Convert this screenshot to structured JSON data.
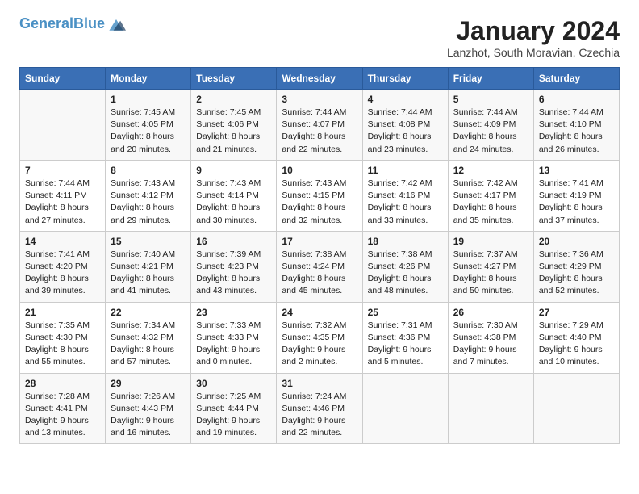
{
  "header": {
    "logo_line1": "General",
    "logo_line2": "Blue",
    "main_title": "January 2024",
    "subtitle": "Lanzhot, South Moravian, Czechia"
  },
  "days_of_week": [
    "Sunday",
    "Monday",
    "Tuesday",
    "Wednesday",
    "Thursday",
    "Friday",
    "Saturday"
  ],
  "weeks": [
    [
      {
        "day": "",
        "info": ""
      },
      {
        "day": "1",
        "info": "Sunrise: 7:45 AM\nSunset: 4:05 PM\nDaylight: 8 hours\nand 20 minutes."
      },
      {
        "day": "2",
        "info": "Sunrise: 7:45 AM\nSunset: 4:06 PM\nDaylight: 8 hours\nand 21 minutes."
      },
      {
        "day": "3",
        "info": "Sunrise: 7:44 AM\nSunset: 4:07 PM\nDaylight: 8 hours\nand 22 minutes."
      },
      {
        "day": "4",
        "info": "Sunrise: 7:44 AM\nSunset: 4:08 PM\nDaylight: 8 hours\nand 23 minutes."
      },
      {
        "day": "5",
        "info": "Sunrise: 7:44 AM\nSunset: 4:09 PM\nDaylight: 8 hours\nand 24 minutes."
      },
      {
        "day": "6",
        "info": "Sunrise: 7:44 AM\nSunset: 4:10 PM\nDaylight: 8 hours\nand 26 minutes."
      }
    ],
    [
      {
        "day": "7",
        "info": "Sunrise: 7:44 AM\nSunset: 4:11 PM\nDaylight: 8 hours\nand 27 minutes."
      },
      {
        "day": "8",
        "info": "Sunrise: 7:43 AM\nSunset: 4:12 PM\nDaylight: 8 hours\nand 29 minutes."
      },
      {
        "day": "9",
        "info": "Sunrise: 7:43 AM\nSunset: 4:14 PM\nDaylight: 8 hours\nand 30 minutes."
      },
      {
        "day": "10",
        "info": "Sunrise: 7:43 AM\nSunset: 4:15 PM\nDaylight: 8 hours\nand 32 minutes."
      },
      {
        "day": "11",
        "info": "Sunrise: 7:42 AM\nSunset: 4:16 PM\nDaylight: 8 hours\nand 33 minutes."
      },
      {
        "day": "12",
        "info": "Sunrise: 7:42 AM\nSunset: 4:17 PM\nDaylight: 8 hours\nand 35 minutes."
      },
      {
        "day": "13",
        "info": "Sunrise: 7:41 AM\nSunset: 4:19 PM\nDaylight: 8 hours\nand 37 minutes."
      }
    ],
    [
      {
        "day": "14",
        "info": "Sunrise: 7:41 AM\nSunset: 4:20 PM\nDaylight: 8 hours\nand 39 minutes."
      },
      {
        "day": "15",
        "info": "Sunrise: 7:40 AM\nSunset: 4:21 PM\nDaylight: 8 hours\nand 41 minutes."
      },
      {
        "day": "16",
        "info": "Sunrise: 7:39 AM\nSunset: 4:23 PM\nDaylight: 8 hours\nand 43 minutes."
      },
      {
        "day": "17",
        "info": "Sunrise: 7:38 AM\nSunset: 4:24 PM\nDaylight: 8 hours\nand 45 minutes."
      },
      {
        "day": "18",
        "info": "Sunrise: 7:38 AM\nSunset: 4:26 PM\nDaylight: 8 hours\nand 48 minutes."
      },
      {
        "day": "19",
        "info": "Sunrise: 7:37 AM\nSunset: 4:27 PM\nDaylight: 8 hours\nand 50 minutes."
      },
      {
        "day": "20",
        "info": "Sunrise: 7:36 AM\nSunset: 4:29 PM\nDaylight: 8 hours\nand 52 minutes."
      }
    ],
    [
      {
        "day": "21",
        "info": "Sunrise: 7:35 AM\nSunset: 4:30 PM\nDaylight: 8 hours\nand 55 minutes."
      },
      {
        "day": "22",
        "info": "Sunrise: 7:34 AM\nSunset: 4:32 PM\nDaylight: 8 hours\nand 57 minutes."
      },
      {
        "day": "23",
        "info": "Sunrise: 7:33 AM\nSunset: 4:33 PM\nDaylight: 9 hours\nand 0 minutes."
      },
      {
        "day": "24",
        "info": "Sunrise: 7:32 AM\nSunset: 4:35 PM\nDaylight: 9 hours\nand 2 minutes."
      },
      {
        "day": "25",
        "info": "Sunrise: 7:31 AM\nSunset: 4:36 PM\nDaylight: 9 hours\nand 5 minutes."
      },
      {
        "day": "26",
        "info": "Sunrise: 7:30 AM\nSunset: 4:38 PM\nDaylight: 9 hours\nand 7 minutes."
      },
      {
        "day": "27",
        "info": "Sunrise: 7:29 AM\nSunset: 4:40 PM\nDaylight: 9 hours\nand 10 minutes."
      }
    ],
    [
      {
        "day": "28",
        "info": "Sunrise: 7:28 AM\nSunset: 4:41 PM\nDaylight: 9 hours\nand 13 minutes."
      },
      {
        "day": "29",
        "info": "Sunrise: 7:26 AM\nSunset: 4:43 PM\nDaylight: 9 hours\nand 16 minutes."
      },
      {
        "day": "30",
        "info": "Sunrise: 7:25 AM\nSunset: 4:44 PM\nDaylight: 9 hours\nand 19 minutes."
      },
      {
        "day": "31",
        "info": "Sunrise: 7:24 AM\nSunset: 4:46 PM\nDaylight: 9 hours\nand 22 minutes."
      },
      {
        "day": "",
        "info": ""
      },
      {
        "day": "",
        "info": ""
      },
      {
        "day": "",
        "info": ""
      }
    ]
  ]
}
